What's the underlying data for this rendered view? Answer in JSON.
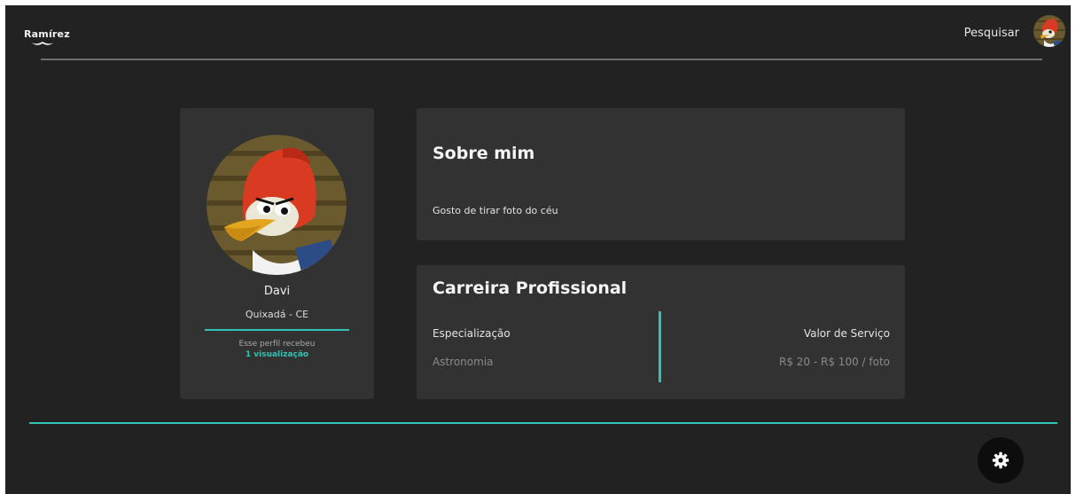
{
  "header": {
    "logo_text": "Ramírez",
    "search_label": "Pesquisar"
  },
  "profile": {
    "name": "Davi",
    "location": "Quixadá - CE",
    "views_text": "Esse perfil recebeu",
    "views_count": "1 visualização"
  },
  "about": {
    "title": "Sobre mim",
    "text": "Gosto de tirar foto do céu"
  },
  "career": {
    "title": "Carreira Profissional",
    "specialization_label": "Especialização",
    "specialization_value": "Astronomia",
    "price_label": "Valor de Serviço",
    "price_value": "R$ 20 - R$ 100 / foto"
  },
  "icons": {
    "settings": "gear-icon",
    "logo_decoration": "mustache-icon"
  },
  "colors": {
    "accent": "#2ec4b6",
    "background": "#222222",
    "card": "#323232"
  }
}
